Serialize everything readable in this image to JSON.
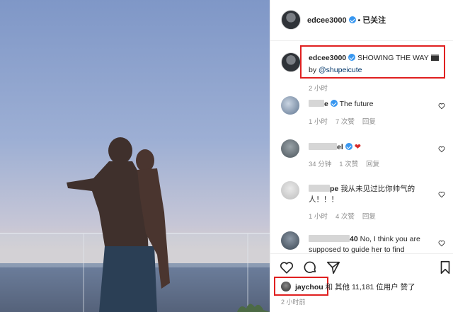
{
  "header": {
    "username": "edcee3000",
    "separator": "•",
    "follow_state": "已关注"
  },
  "caption": {
    "username": "edcee3000",
    "text": "SHOWING THE WAY",
    "credit_prefix": "by",
    "mention": "@shupeicute",
    "time": "2 小时"
  },
  "comments": [
    {
      "user_visible": "e",
      "text": "The future",
      "time": "1 小时",
      "likes": "7 次赞",
      "reply": "回复"
    },
    {
      "user_visible": "el",
      "text": "",
      "time": "34 分钟",
      "likes": "1 次赞",
      "reply": "回复"
    },
    {
      "user_visible": "pe",
      "text": "我从未见过比你帅气的人！！！",
      "time": "1 小时",
      "likes": "4 次赞",
      "reply": "回复"
    },
    {
      "user_visible": "40",
      "text": "No, I think you are supposed to guide her to find"
    }
  ],
  "likes": {
    "liker": "jaychou",
    "text": "和 其他 11,181 位用户 赞了"
  },
  "post_time": "2 小时前",
  "icons": [
    "heart-icon",
    "comment-icon",
    "share-icon",
    "bookmark-icon",
    "verified-icon",
    "clapperboard-icon",
    "red-heart-emoji"
  ],
  "colors": {
    "accent": "#3897f0",
    "highlight": "#e02020",
    "muted": "#8e8e8e"
  }
}
